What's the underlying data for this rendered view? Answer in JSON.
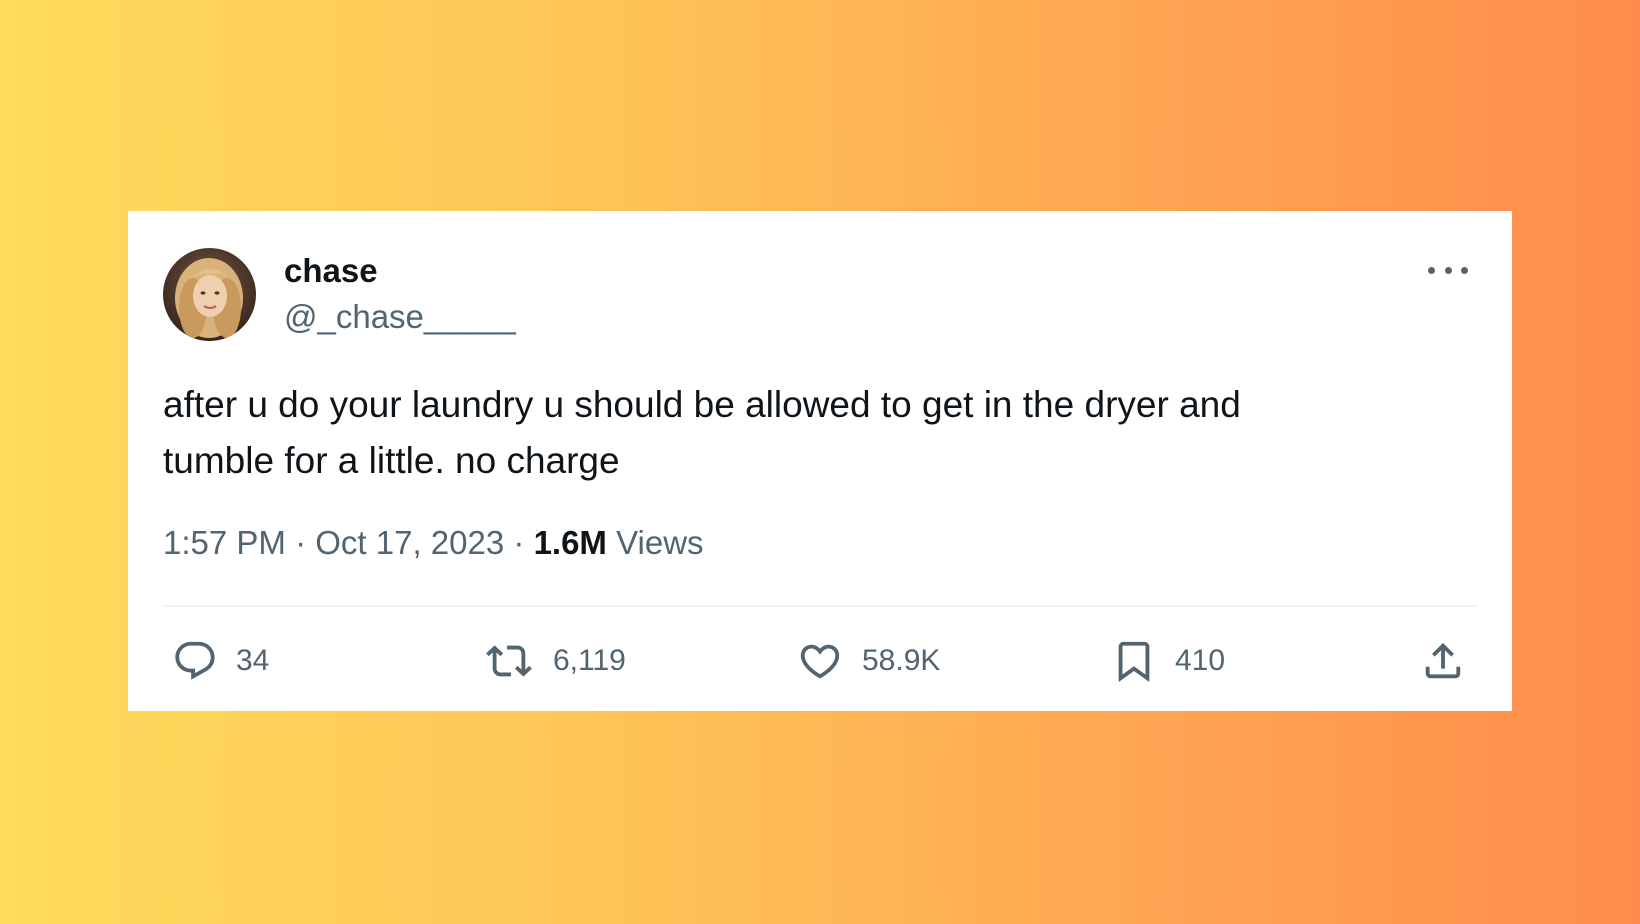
{
  "colors": {
    "background_gradient": [
      "#ffdb5c",
      "#fec657",
      "#ffa552",
      "#ff8c4c"
    ],
    "card": "#ffffff",
    "text_primary": "#0f1419",
    "text_secondary": "#536471",
    "divider": "#eff3f4"
  },
  "tweet": {
    "author": {
      "display_name": "chase",
      "handle": "@_chase_____",
      "avatar_icon": "profile-photo"
    },
    "text_lines": [
      "after u do your laundry u should be allowed to get in the dryer and",
      "tumble for a little. no charge"
    ],
    "meta": {
      "time": "1:57 PM",
      "separator": "·",
      "date": "Oct 17, 2023",
      "views_count": "1.6M",
      "views_label": "Views"
    },
    "actions": {
      "reply": {
        "icon": "reply-icon",
        "count": "34"
      },
      "retweet": {
        "icon": "retweet-icon",
        "count": "6,119"
      },
      "like": {
        "icon": "heart-icon",
        "count": "58.9K"
      },
      "bookmark": {
        "icon": "bookmark-icon",
        "count": "410"
      },
      "share": {
        "icon": "share-icon"
      }
    },
    "more_icon": "more-horizontal-icon"
  }
}
